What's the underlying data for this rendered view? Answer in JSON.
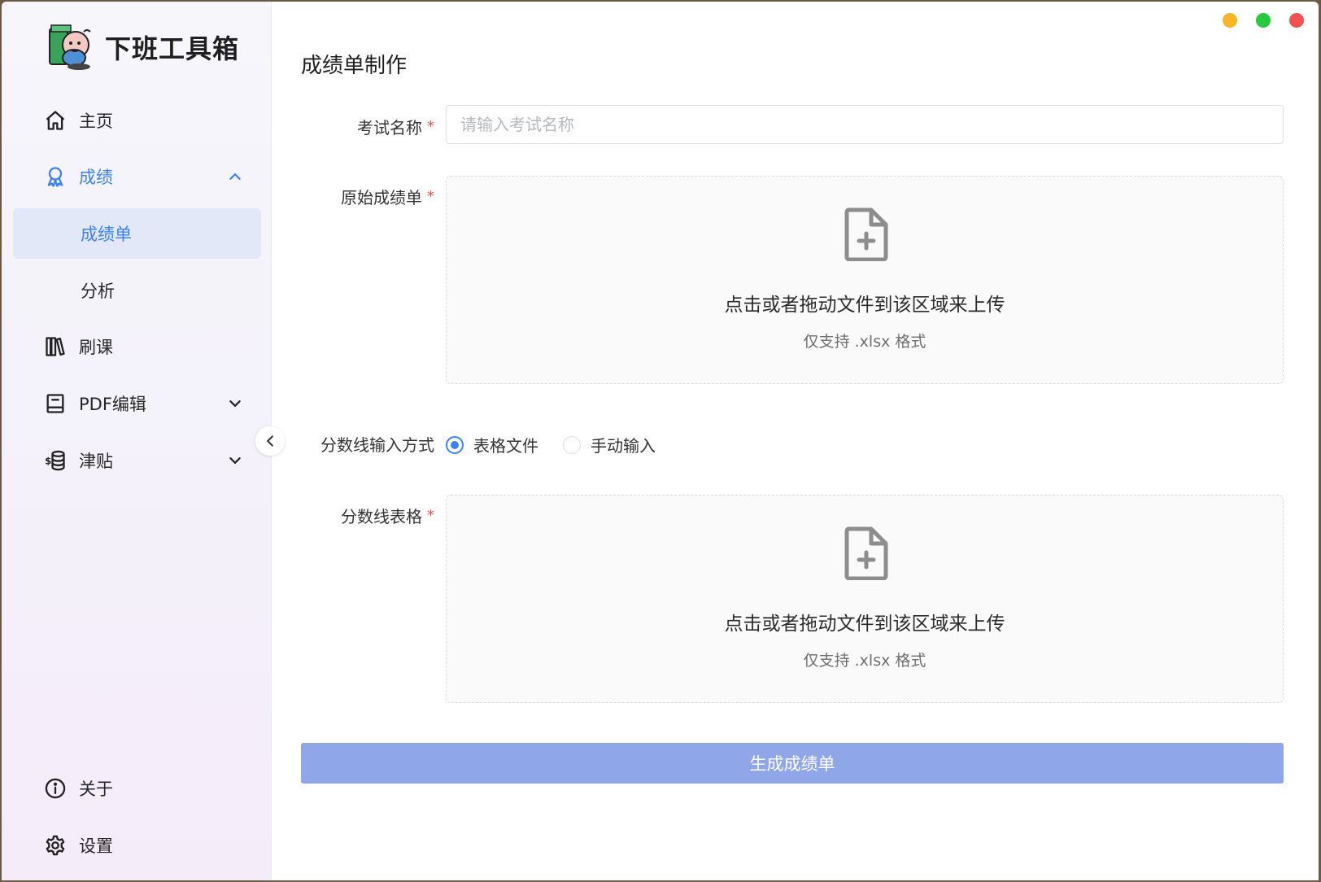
{
  "app": {
    "title": "下班工具箱",
    "logo_icon": "cartoon-character-logo"
  },
  "window_controls": {
    "minimize_color": "#f8b626",
    "maximize_color": "#27c93f",
    "close_color": "#f0524f"
  },
  "sidebar": {
    "items": [
      {
        "label": "主页",
        "icon": "home-icon"
      },
      {
        "label": "成绩",
        "icon": "award-icon",
        "expanded": true
      },
      {
        "label": "成绩单",
        "sub": true,
        "active": true
      },
      {
        "label": "分析",
        "sub": true
      },
      {
        "label": "刷课",
        "icon": "books-icon"
      },
      {
        "label": "PDF编辑",
        "icon": "book-icon",
        "expanded": false
      },
      {
        "label": "津贴",
        "icon": "money-icon",
        "expanded": false
      }
    ],
    "bottom": [
      {
        "label": "关于",
        "icon": "info-icon"
      },
      {
        "label": "设置",
        "icon": "gear-icon"
      }
    ]
  },
  "main": {
    "title": "成绩单制作",
    "exam_name": {
      "label": "考试名称",
      "placeholder": "请输入考试名称",
      "value": ""
    },
    "original_upload": {
      "label": "原始成绩单",
      "text": "点击或者拖动文件到该区域来上传",
      "hint": "仅支持 .xlsx 格式"
    },
    "score_line_method": {
      "label": "分数线输入方式",
      "options": [
        "表格文件",
        "手动输入"
      ],
      "selected": "表格文件"
    },
    "score_line_upload": {
      "label": "分数线表格",
      "text": "点击或者拖动文件到该区域来上传",
      "hint": "仅支持 .xlsx 格式"
    },
    "submit_label": "生成成绩单"
  },
  "accent_color": "#3b82f6"
}
